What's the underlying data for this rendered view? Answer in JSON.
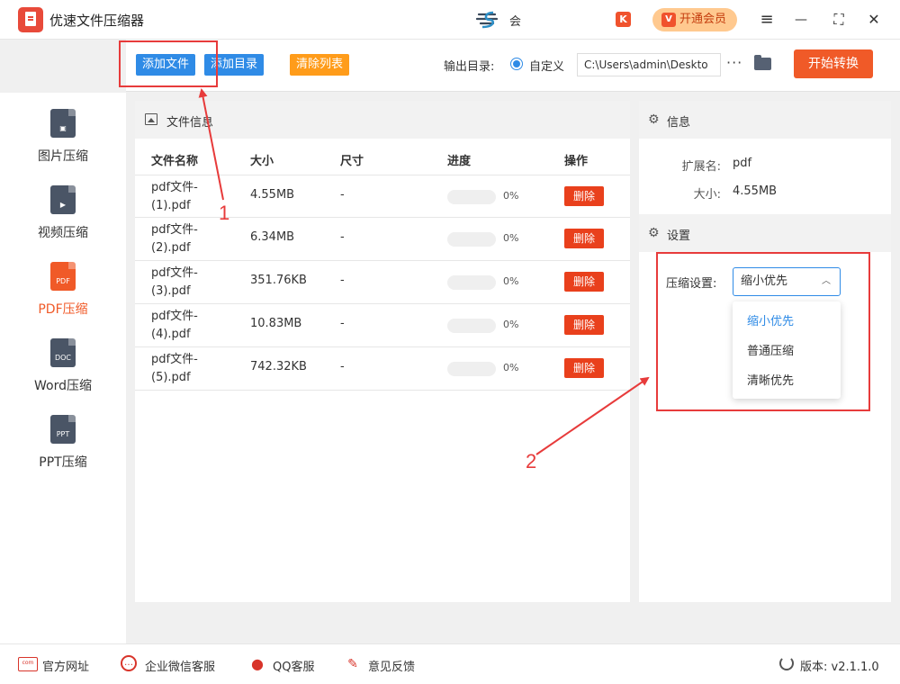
{
  "app": {
    "title": "优速文件压缩器",
    "user_name": "会",
    "vip_label": "开通会员",
    "k_badge": "K",
    "vip_badge": "V"
  },
  "window_controls": {
    "menu": "≡",
    "minimize": "—",
    "fullscreen": "⛶",
    "close": "✕"
  },
  "sidebar": {
    "items": [
      {
        "label": "图片压缩",
        "icon": "image-file-icon",
        "badge": "▣",
        "active": false
      },
      {
        "label": "视频压缩",
        "icon": "video-file-icon",
        "badge": "▶",
        "active": false
      },
      {
        "label": "PDF压缩",
        "icon": "pdf-file-icon",
        "badge": "PDF",
        "active": true
      },
      {
        "label": "Word压缩",
        "icon": "doc-file-icon",
        "badge": "DOC",
        "active": false
      },
      {
        "label": "PPT压缩",
        "icon": "ppt-file-icon",
        "badge": "PPT",
        "active": false
      }
    ]
  },
  "toolbar": {
    "add_file": "添加文件",
    "add_folder": "添加目录",
    "clear_list": "清除列表",
    "output_label": "输出目录:",
    "custom_label": "自定义",
    "output_path": "C:\\Users\\admin\\Deskto",
    "more": "···",
    "start": "开始转换"
  },
  "file_panel": {
    "title": "文件信息",
    "columns": [
      "文件名称",
      "大小",
      "尺寸",
      "进度",
      "操作"
    ],
    "rows": [
      {
        "name_line1": "pdf文件-",
        "name_line2": "(1).pdf",
        "size": "4.55MB",
        "dimension": "-",
        "progress": 0,
        "progress_text": "0%",
        "action": "删除"
      },
      {
        "name_line1": "pdf文件-",
        "name_line2": "(2).pdf",
        "size": "6.34MB",
        "dimension": "-",
        "progress": 0,
        "progress_text": "0%",
        "action": "删除"
      },
      {
        "name_line1": "pdf文件-",
        "name_line2": "(3).pdf",
        "size": "351.76KB",
        "dimension": "-",
        "progress": 0,
        "progress_text": "0%",
        "action": "删除"
      },
      {
        "name_line1": "pdf文件-",
        "name_line2": "(4).pdf",
        "size": "10.83MB",
        "dimension": "-",
        "progress": 0,
        "progress_text": "0%",
        "action": "删除"
      },
      {
        "name_line1": "pdf文件-",
        "name_line2": "(5).pdf",
        "size": "742.32KB",
        "dimension": "-",
        "progress": 0,
        "progress_text": "0%",
        "action": "删除"
      }
    ]
  },
  "info_panel": {
    "title": "信息",
    "ext_label": "扩展名:",
    "ext_value": "pdf",
    "size_label": "大小:",
    "size_value": "4.55MB"
  },
  "settings_panel": {
    "title": "设置",
    "compress_label": "压缩设置:",
    "selected": "缩小优先",
    "options": [
      "缩小优先",
      "普通压缩",
      "清晰优先"
    ]
  },
  "bottom_bar": {
    "website": "官方网址",
    "wechat": "企业微信客服",
    "qq": "QQ客服",
    "feedback": "意见反馈",
    "version_label": "版本:",
    "version": "v2.1.1.0",
    "com_text": "com"
  },
  "annotations": {
    "label1": "1",
    "label2": "2"
  },
  "colors": {
    "accent_blue": "#2f8be6",
    "accent_orange": "#f05a28",
    "delete_red": "#e9401c",
    "annotation_red": "#e73b3b"
  }
}
